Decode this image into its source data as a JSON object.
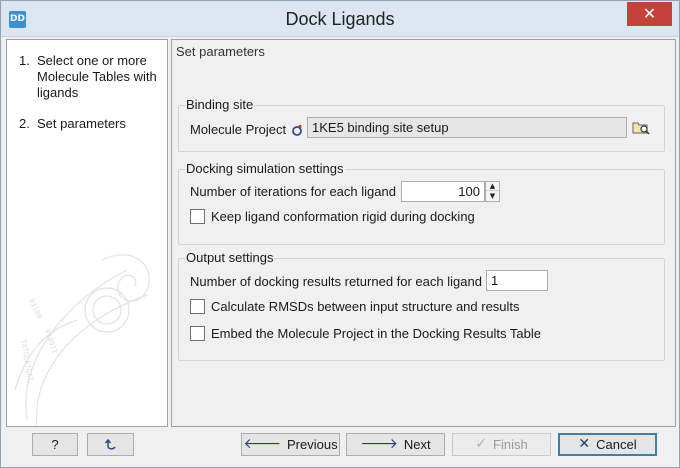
{
  "window": {
    "title": "Dock Ligands",
    "app_icon_text": "DD",
    "close_glyph": "✕"
  },
  "steps": [
    {
      "num": "1.",
      "label": "Select one or more Molecule Tables with ligands"
    },
    {
      "num": "2.",
      "label": "Set parameters"
    }
  ],
  "main": {
    "heading": "Set parameters",
    "binding_site": {
      "group_label": "Binding site",
      "molecule_project_label": "Molecule Project",
      "molecule_project_value": "1KE5 binding site setup"
    },
    "docking": {
      "group_label": "Docking simulation settings",
      "iterations_label": "Number of iterations for each ligand",
      "iterations_value": "100",
      "rigid_label": "Keep ligand conformation rigid during docking",
      "rigid_checked": false
    },
    "output": {
      "group_label": "Output settings",
      "results_label": "Number of docking results returned for each ligand",
      "results_value": "1",
      "rmsd_label": "Calculate RMSDs between input structure and results",
      "rmsd_checked": false,
      "embed_label": "Embed the Molecule Project in the Docking Results Table",
      "embed_checked": false
    }
  },
  "buttons": {
    "help": "?",
    "reset_icon": "reset-icon",
    "previous": "Previous",
    "next": "Next",
    "finish": "Finish",
    "cancel": "Cancel"
  },
  "colors": {
    "titlebar": "#dce6f0",
    "close": "#c7413c",
    "accent_border": "#3c7fb1"
  }
}
